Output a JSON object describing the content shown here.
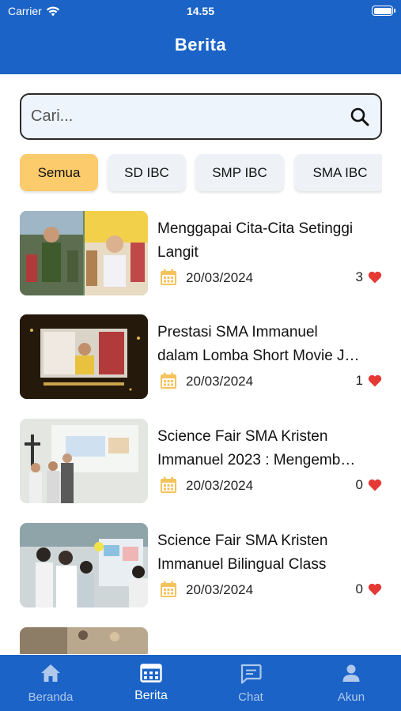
{
  "status_bar": {
    "carrier": "Carrier",
    "time": "14.55"
  },
  "header": {
    "title": "Berita"
  },
  "search": {
    "placeholder": "Cari...",
    "value": ""
  },
  "categories": [
    {
      "label": "Semua",
      "selected": true
    },
    {
      "label": "SD IBC",
      "selected": false
    },
    {
      "label": "SMP IBC",
      "selected": false
    },
    {
      "label": "SMA IBC",
      "selected": false
    }
  ],
  "news": [
    {
      "title_line1": "Menggapai Cita-Cita Setinggi",
      "title_line2": "Langit",
      "date": "20/03/2024",
      "likes": "3"
    },
    {
      "title_line1": "Prestasi SMA Immanuel",
      "title_line2": "dalam Lomba Short Movie J…",
      "date": "20/03/2024",
      "likes": "1"
    },
    {
      "title_line1": "Science Fair SMA Kristen",
      "title_line2": "Immanuel 2023 : Mengemb…",
      "date": "20/03/2024",
      "likes": "0"
    },
    {
      "title_line1": "Science Fair SMA Kristen",
      "title_line2": "Immanuel Bilingual Class",
      "date": "20/03/2024",
      "likes": "0"
    }
  ],
  "bottom_nav": [
    {
      "label": "Beranda",
      "icon": "home-icon",
      "active": false
    },
    {
      "label": "Berita",
      "icon": "news-icon",
      "active": true
    },
    {
      "label": "Chat",
      "icon": "chat-icon",
      "active": false
    },
    {
      "label": "Akun",
      "icon": "account-icon",
      "active": false
    }
  ],
  "colors": {
    "primary": "#1b63c7",
    "chip_active": "#fccb6c",
    "chip_inactive": "#eef2f7",
    "heart": "#e53935",
    "calendar": "#f5c35c"
  }
}
